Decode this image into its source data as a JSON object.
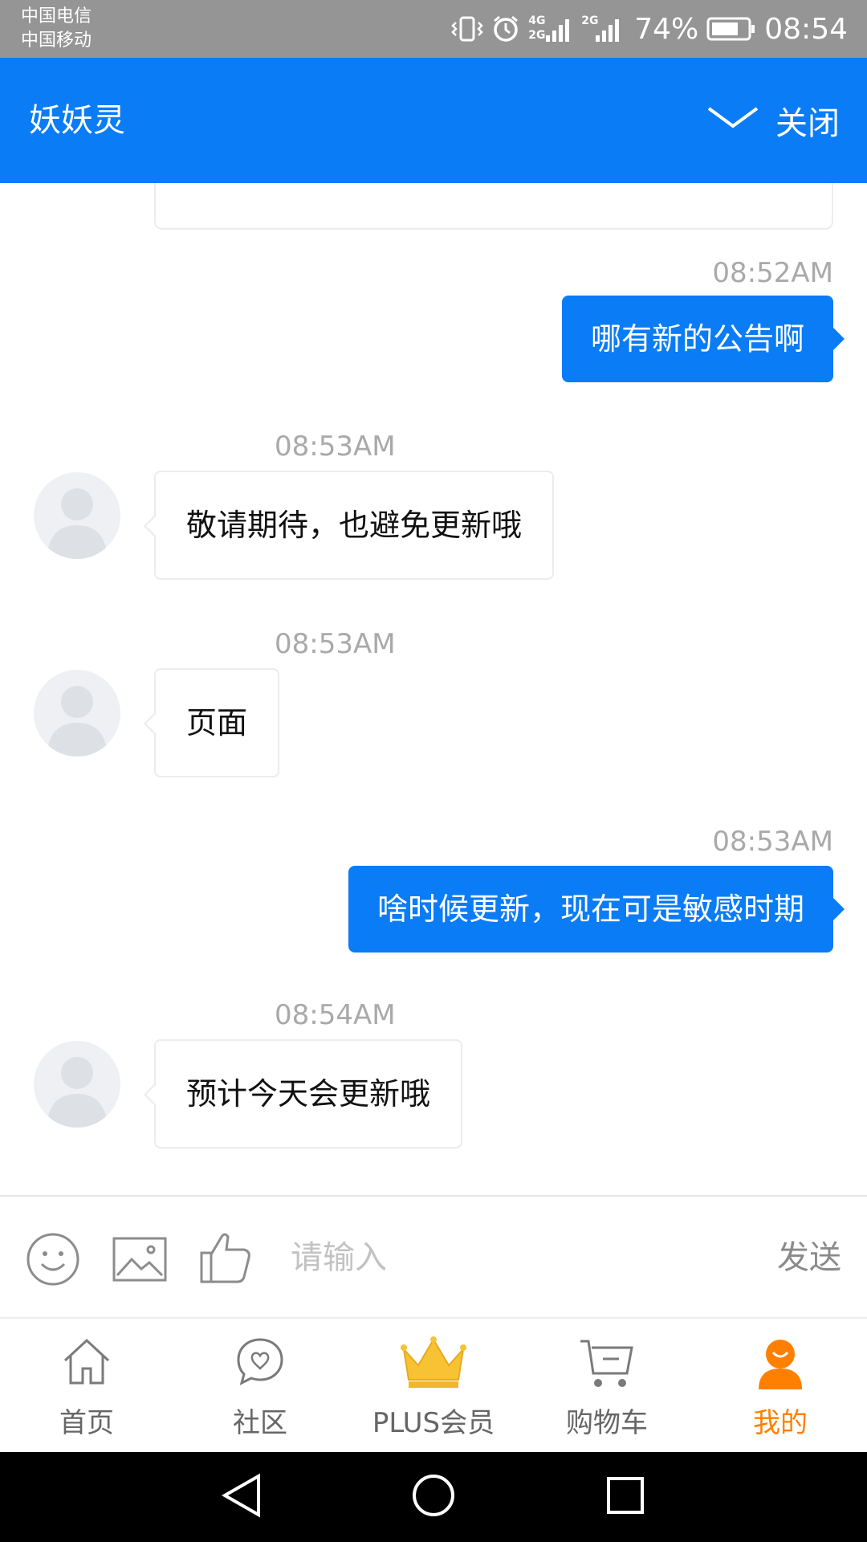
{
  "status_bar": {
    "carrier_1": "中国电信",
    "carrier_2": "中国移动",
    "network_1": "4G",
    "network_1b": "2G",
    "network_2": "2G",
    "battery": "74%",
    "time": "08:54"
  },
  "header": {
    "title": "妖妖灵",
    "close_label": "关闭"
  },
  "messages": [
    {
      "direction": "out",
      "time": "08:52AM",
      "text": "哪有新的公告啊"
    },
    {
      "direction": "in",
      "time": "08:53AM",
      "text": "敬请期待，也避免更新哦"
    },
    {
      "direction": "in",
      "time": "08:53AM",
      "text": "页面"
    },
    {
      "direction": "out",
      "time": "08:53AM",
      "text": "啥时候更新，现在可是敏感时期"
    },
    {
      "direction": "in",
      "time": "08:54AM",
      "text": "预计今天会更新哦"
    }
  ],
  "input_bar": {
    "placeholder": "请输入",
    "value": "",
    "send_label": "发送"
  },
  "bottom_nav": {
    "items": [
      {
        "label": "首页",
        "icon": "home-icon"
      },
      {
        "label": "社区",
        "icon": "community-icon"
      },
      {
        "label": "PLUS会员",
        "icon": "crown-icon"
      },
      {
        "label": "购物车",
        "icon": "cart-icon"
      },
      {
        "label": "我的",
        "icon": "profile-icon"
      }
    ],
    "active_index": 4,
    "active_color": "#ff7f00"
  },
  "colors": {
    "brand_blue": "#0a7cf5",
    "status_bar_gray": "#959595"
  }
}
